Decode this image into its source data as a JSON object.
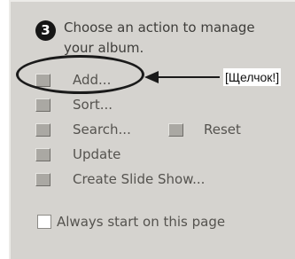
{
  "step": {
    "number": "3",
    "heading": "Choose an action to manage your album."
  },
  "actions": {
    "add_label": "Add...",
    "sort_label": "Sort...",
    "search_label": "Search...",
    "reset_label": "Reset",
    "update_label": "Update",
    "slideshow_label": "Create Slide Show..."
  },
  "checkbox": {
    "label": "Always start on this page",
    "checked": false
  },
  "annotation": {
    "callout_text": "[Щелчок!]"
  },
  "colors": {
    "panel_background": "#d5d3cf",
    "text": "#55534f",
    "annotation": "#1a1a1a"
  }
}
